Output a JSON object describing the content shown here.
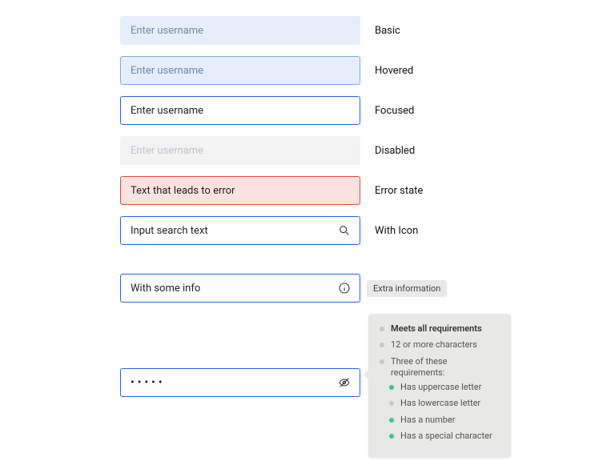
{
  "states": {
    "basic": {
      "placeholder": "Enter username",
      "label": "Basic"
    },
    "hovered": {
      "placeholder": "Enter username",
      "label": "Hovered"
    },
    "focused": {
      "placeholder": "Enter username",
      "label": "Focused"
    },
    "disabled": {
      "placeholder": "Enter username",
      "label": "Disabled"
    },
    "error": {
      "value": "Text that leads to error",
      "label": "Error state"
    },
    "withicon": {
      "placeholder": "Input search text",
      "label": "With Icon"
    },
    "info": {
      "placeholder": "With some info",
      "tooltip": "Extra information"
    }
  },
  "password": {
    "masked": "•••••",
    "requirements": {
      "title": "Meets all requirements",
      "r1": "12 or more characters",
      "r2": "Three of these requirements:",
      "sub": {
        "a": "Has uppercase letter",
        "b": "Has lowercase letter",
        "c": "Has a number",
        "d": "Has a special character"
      },
      "met": {
        "title": false,
        "r1": false,
        "r2": false,
        "a": true,
        "b": false,
        "c": true,
        "d": true
      }
    }
  },
  "colors": {
    "accent": "#2563eb",
    "error": "#e64a3b",
    "success": "#3ec97a"
  }
}
